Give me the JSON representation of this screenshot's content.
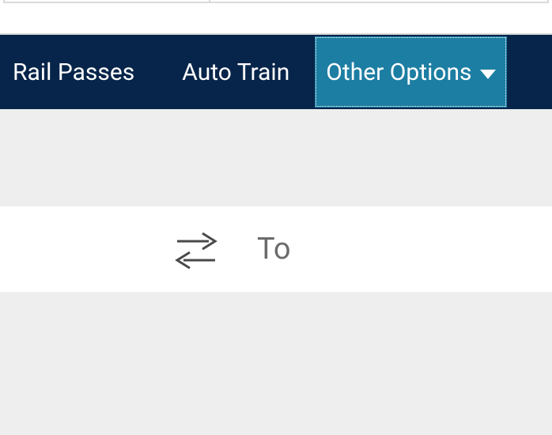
{
  "nav": {
    "items": [
      {
        "label": "Rail Passes"
      },
      {
        "label": "Auto Train"
      },
      {
        "label": "Other Options"
      }
    ],
    "activeIndex": 2
  },
  "search": {
    "to_placeholder": "To"
  },
  "icons": {
    "swap": "swap-icon",
    "caret": "chevron-down-icon"
  },
  "colors": {
    "navbar_bg": "#07254a",
    "active_tab_bg": "#1d7ea3",
    "page_bg": "#eeeeee",
    "placeholder": "#6b6b6b"
  }
}
